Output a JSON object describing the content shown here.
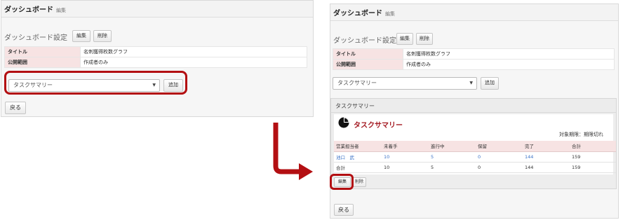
{
  "before": {
    "header_title": "ダッシュボード",
    "header_edit": "編集",
    "section_title": "ダッシュボード設定",
    "edit_btn": "編集",
    "delete_btn": "削除",
    "rows": [
      {
        "label": "タイトル",
        "value": "名刺獲得枚数グラフ"
      },
      {
        "label": "公開範囲",
        "value": "作成者のみ"
      }
    ],
    "select_value": "タスクサマリー",
    "add_btn": "追加",
    "back_btn": "戻る"
  },
  "after": {
    "header_title": "ダッシュボード",
    "header_edit": "編集",
    "section_title": "ダッシュボード設定",
    "edit_btn": "編集",
    "delete_btn": "削除",
    "rows": [
      {
        "label": "タイトル",
        "value": "名刺獲得枚数グラフ"
      },
      {
        "label": "公開範囲",
        "value": "作成者のみ"
      }
    ],
    "select_value": "タスクサマリー",
    "add_btn": "追加",
    "summary": {
      "panel_title": "タスクサマリー",
      "title": "タスクサマリー",
      "period": "対象期限：期限切れ",
      "columns": [
        "営業担当者",
        "未着手",
        "進行中",
        "保留",
        "完了",
        "合計"
      ],
      "rows": [
        [
          "池口　武",
          "10",
          "5",
          "0",
          "144",
          "159"
        ],
        [
          "合計",
          "10",
          "5",
          "0",
          "144",
          "159"
        ]
      ],
      "edit_btn": "編集",
      "delete_btn": "削除"
    },
    "back_btn": "戻る"
  },
  "colors": {
    "highlight": "#b30f12",
    "label_bg": "#f7e3e3",
    "link": "#3b73c7",
    "summary_title": "#a31820"
  }
}
